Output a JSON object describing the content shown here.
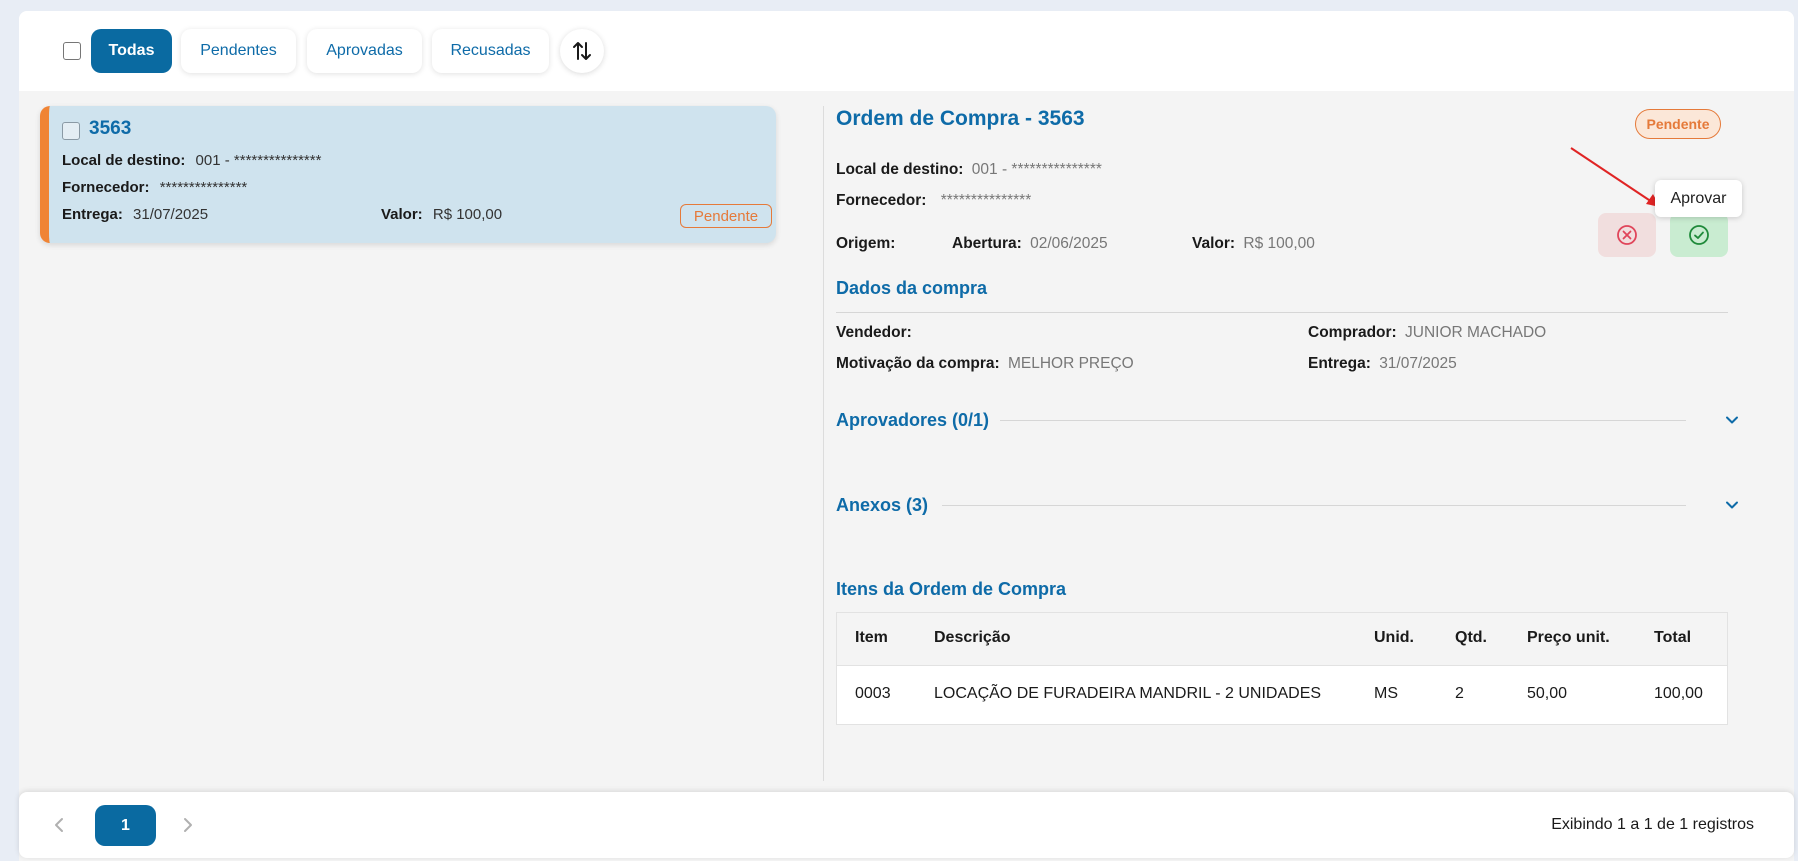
{
  "filters": {
    "tabs": [
      "Todas",
      "Pendentes",
      "Aprovadas",
      "Recusadas"
    ],
    "active": "Todas",
    "sort_icon": "sort-arrows-icon"
  },
  "list": {
    "card": {
      "number": "3563",
      "local_label": "Local de destino:",
      "local_value": "001 -   ***************",
      "fornecedor_label": "Fornecedor:",
      "fornecedor_value": "***************",
      "entrega_label": "Entrega:",
      "entrega_value": "31/07/2025",
      "valor_label": "Valor:",
      "valor_value": "R$ 100,00",
      "status": "Pendente"
    }
  },
  "detail": {
    "title": "Ordem de Compra - 3563",
    "status": "Pendente",
    "local_label": "Local de destino:",
    "local_value": "001 -  ***************",
    "fornecedor_label": "Fornecedor:",
    "fornecedor_value": "***************",
    "origem_label": "Origem:",
    "abertura_label": "Abertura:",
    "abertura_value": "02/06/2025",
    "valor_label": "Valor:",
    "valor_value": "R$ 100,00",
    "tooltip": "Aprovar",
    "dados_title": "Dados da compra",
    "vendedor_label": "Vendedor:",
    "comprador_label": "Comprador:",
    "comprador_value": "JUNIOR MACHADO",
    "motivacao_label": "Motivação da compra:",
    "motivacao_value": "MELHOR PREÇO",
    "entrega_label": "Entrega:",
    "entrega_value": "31/07/2025",
    "aprovadores_title": "Aprovadores (0/1)",
    "anexos_title": "Anexos (3)",
    "itens_title": "Itens da Ordem de Compra",
    "table": {
      "headers": [
        "Item",
        "Descrição",
        "Unid.",
        "Qtd.",
        "Preço unit.",
        "Total"
      ],
      "rows": [
        [
          "0003",
          "LOCAÇÃO DE FURADEIRA MANDRIL - 2 UNIDADES",
          "MS",
          "2",
          "50,00",
          "100,00"
        ]
      ]
    }
  },
  "footer": {
    "page": "1",
    "info": "Exibindo 1 a 1 de 1 registros"
  },
  "colors": {
    "primary": "#0a6aa1",
    "pending": "#e57a3a",
    "card_bg": "#cfe3ee",
    "approve_bg": "#c9ecd1",
    "reject_bg": "#f1dede",
    "arrow": "#e02424"
  }
}
